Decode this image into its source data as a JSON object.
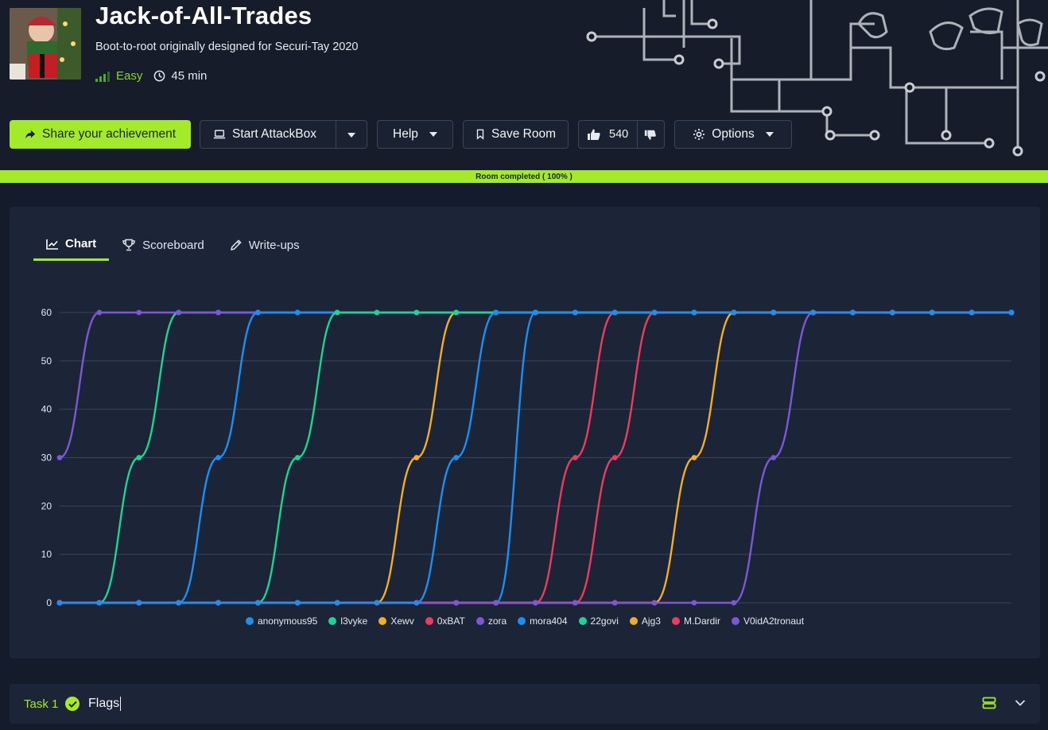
{
  "room": {
    "title": "Jack-of-All-Trades",
    "subtitle": "Boot-to-root originally designed for Securi-Tay 2020",
    "difficulty": "Easy",
    "time": "45 min",
    "image_icon": "elf-on-shelf-thumbnail"
  },
  "actions": {
    "share": "Share your achievement",
    "attackbox": "Start AttackBox",
    "help": "Help",
    "save": "Save Room",
    "likes": "540",
    "options": "Options"
  },
  "progress": {
    "label": "Room completed ( 100% )",
    "percent": 100
  },
  "tabs": [
    {
      "label": "Chart",
      "icon": "line-chart-icon",
      "active": true
    },
    {
      "label": "Scoreboard",
      "icon": "trophy-icon",
      "active": false
    },
    {
      "label": "Write-ups",
      "icon": "pencil-icon",
      "active": false
    }
  ],
  "chart_data": {
    "type": "line",
    "x": [
      0,
      1,
      2,
      3,
      4,
      5,
      6,
      7,
      8,
      9,
      10,
      11,
      12,
      13,
      14,
      15,
      16,
      17,
      18,
      19,
      20,
      21,
      22,
      23,
      24
    ],
    "ylim": [
      0,
      60
    ],
    "yticks": [
      0,
      10,
      20,
      30,
      40,
      50,
      60
    ],
    "grid": true,
    "legend_position": "bottom",
    "series": [
      {
        "name": "anonymous95",
        "color": "#1e8ff2",
        "values": [
          0,
          0,
          0,
          0,
          0,
          0,
          0,
          0,
          0,
          0,
          0,
          0,
          60,
          60,
          60,
          60,
          60,
          60,
          60,
          60,
          60,
          60,
          60,
          60,
          60
        ]
      },
      {
        "name": "l3vyke",
        "color": "#1fd490",
        "values": [
          0,
          0,
          30,
          60,
          60,
          60,
          60,
          60,
          60,
          60,
          60,
          60,
          60,
          60,
          60,
          60,
          60,
          60,
          60,
          60,
          60,
          60,
          60,
          60,
          60
        ]
      },
      {
        "name": "Xewv",
        "color": "#f5ad24",
        "values": [
          0,
          0,
          0,
          0,
          0,
          0,
          0,
          0,
          0,
          30,
          60,
          60,
          60,
          60,
          60,
          60,
          60,
          60,
          60,
          60,
          60,
          60,
          60,
          60,
          60
        ]
      },
      {
        "name": "0xBAT",
        "color": "#ee3c5c",
        "values": [
          0,
          0,
          0,
          0,
          0,
          0,
          0,
          0,
          0,
          0,
          0,
          0,
          0,
          30,
          60,
          60,
          60,
          60,
          60,
          60,
          60,
          60,
          60,
          60,
          60
        ]
      },
      {
        "name": "zora",
        "color": "#7d57d6",
        "values": [
          30,
          60,
          60,
          60,
          60,
          60,
          60,
          60,
          60,
          60,
          60,
          60,
          60,
          60,
          60,
          60,
          60,
          60,
          60,
          60,
          60,
          60,
          60,
          60,
          60
        ]
      },
      {
        "name": "mora404",
        "color": "#1e8ff2",
        "values": [
          0,
          0,
          0,
          0,
          30,
          60,
          60,
          60,
          60,
          60,
          60,
          60,
          60,
          60,
          60,
          60,
          60,
          60,
          60,
          60,
          60,
          60,
          60,
          60,
          60
        ]
      },
      {
        "name": "22govi",
        "color": "#1fd490",
        "values": [
          0,
          0,
          0,
          0,
          0,
          0,
          30,
          60,
          60,
          60,
          60,
          60,
          60,
          60,
          60,
          60,
          60,
          60,
          60,
          60,
          60,
          60,
          60,
          60,
          60
        ]
      },
      {
        "name": "Ajg3",
        "color": "#f5ad24",
        "values": [
          0,
          0,
          0,
          0,
          0,
          0,
          0,
          0,
          0,
          0,
          0,
          0,
          0,
          0,
          0,
          0,
          30,
          60,
          60,
          60,
          60,
          60,
          60,
          60,
          60
        ]
      },
      {
        "name": "M.Dardir",
        "color": "#ee3c5c",
        "values": [
          0,
          0,
          0,
          0,
          0,
          0,
          0,
          0,
          0,
          0,
          0,
          0,
          0,
          0,
          30,
          60,
          60,
          60,
          60,
          60,
          60,
          60,
          60,
          60,
          60
        ]
      },
      {
        "name": "V0idA2tronaut",
        "color": "#7d57d6",
        "values": [
          0,
          0,
          0,
          0,
          0,
          0,
          0,
          0,
          0,
          0,
          0,
          0,
          0,
          0,
          0,
          0,
          0,
          0,
          30,
          60,
          60,
          60,
          60,
          60,
          60
        ]
      },
      {
        "name": "",
        "color": "#1e8ff2",
        "values": [
          0,
          0,
          0,
          0,
          0,
          0,
          0,
          0,
          0,
          0,
          30,
          60,
          60,
          60,
          60,
          60,
          60,
          60,
          60,
          60,
          60,
          60,
          60,
          60,
          60
        ]
      }
    ]
  },
  "task": {
    "label": "Task 1",
    "name": "Flags"
  },
  "colors": {
    "accent": "#a3ea2a",
    "background": "#141b2b",
    "panel": "#1c2538"
  }
}
